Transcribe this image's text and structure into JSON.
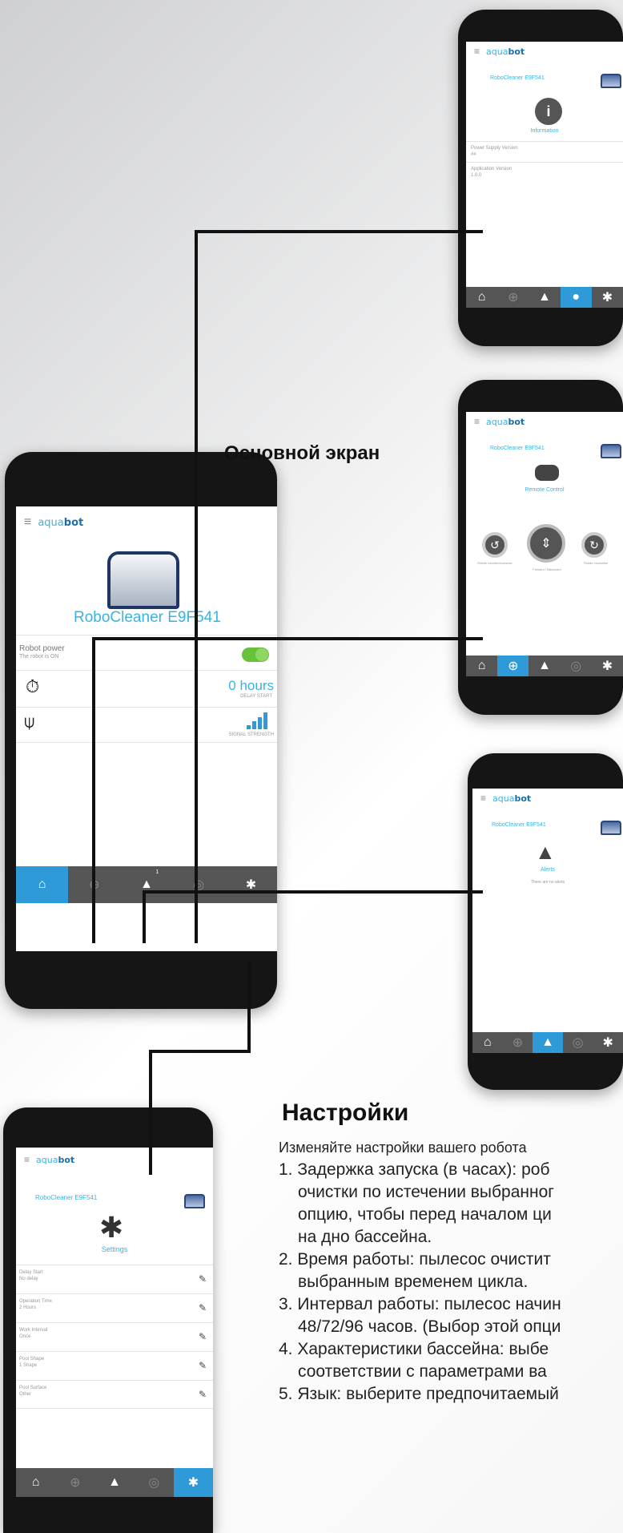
{
  "labels": {
    "main_screen": "Основной экран",
    "settings_heading": "Настройки"
  },
  "settings_description": {
    "intro": "Изменяйте настройки вашего робота",
    "lines": [
      "1. Задержка запуска (в часах): роб",
      "очистки по истечении выбранног",
      "опцию, чтобы перед началом ци",
      "на дно бассейна.",
      "2. Время работы: пылесос очистит",
      "выбранным временем цикла.",
      "3. Интервал работы: пылесос начин",
      "48/72/96 часов. (Выбор этой опци",
      "4. Характеристики бассейна: выбе",
      "соответствии с параметрами ва",
      "5. Язык: выберите предпочитаемый"
    ]
  },
  "main_phone": {
    "brand_prefix": "aqua",
    "brand_suffix": "bot",
    "device_name": "RoboCleaner E9F541",
    "robot_power_label": "Robot power",
    "robot_power_status": "The robot is ON",
    "delay_value": "0 hours",
    "delay_label": "DELAY START",
    "signal_label": "SIGNAL STRENGTH",
    "alerts_badge": "1"
  },
  "info_phone": {
    "brand_prefix": "aqua",
    "brand_suffix": "bot",
    "device_name": "RoboCleaner E9F541",
    "title": "Information",
    "field1_label": "Power Supply Version",
    "field1_value": "##",
    "field2_label": "Application Version",
    "field2_value": "1.0.0"
  },
  "remote_phone": {
    "brand_prefix": "aqua",
    "brand_suffix": "bot",
    "device_name": "RoboCleaner E9F541",
    "title": "Remote Control",
    "left_caption": "Rotate counterclockwise",
    "center_caption": "Forward / Backward",
    "right_caption": "Rotate clockwise"
  },
  "alerts_phone": {
    "brand_prefix": "aqua",
    "brand_suffix": "bot",
    "device_name": "RoboCleaner E9F541",
    "title": "Alerts",
    "empty_text": "There are no alerts"
  },
  "settings_phone": {
    "brand_prefix": "aqua",
    "brand_suffix": "bot",
    "device_name": "RoboCleaner E9F541",
    "title": "Settings",
    "rows": [
      {
        "label": "Delay Start",
        "value": "No delay"
      },
      {
        "label": "Operation Time",
        "value": "2 Hours"
      },
      {
        "label": "Work Interval",
        "value": "Once"
      },
      {
        "label": "Pool Shape",
        "value": "1 Shape"
      },
      {
        "label": "Pool Surface",
        "value": "Other"
      }
    ]
  },
  "colors": {
    "accent": "#2e9ad7",
    "toggle": "#66c23a",
    "tabbar": "#555555"
  }
}
